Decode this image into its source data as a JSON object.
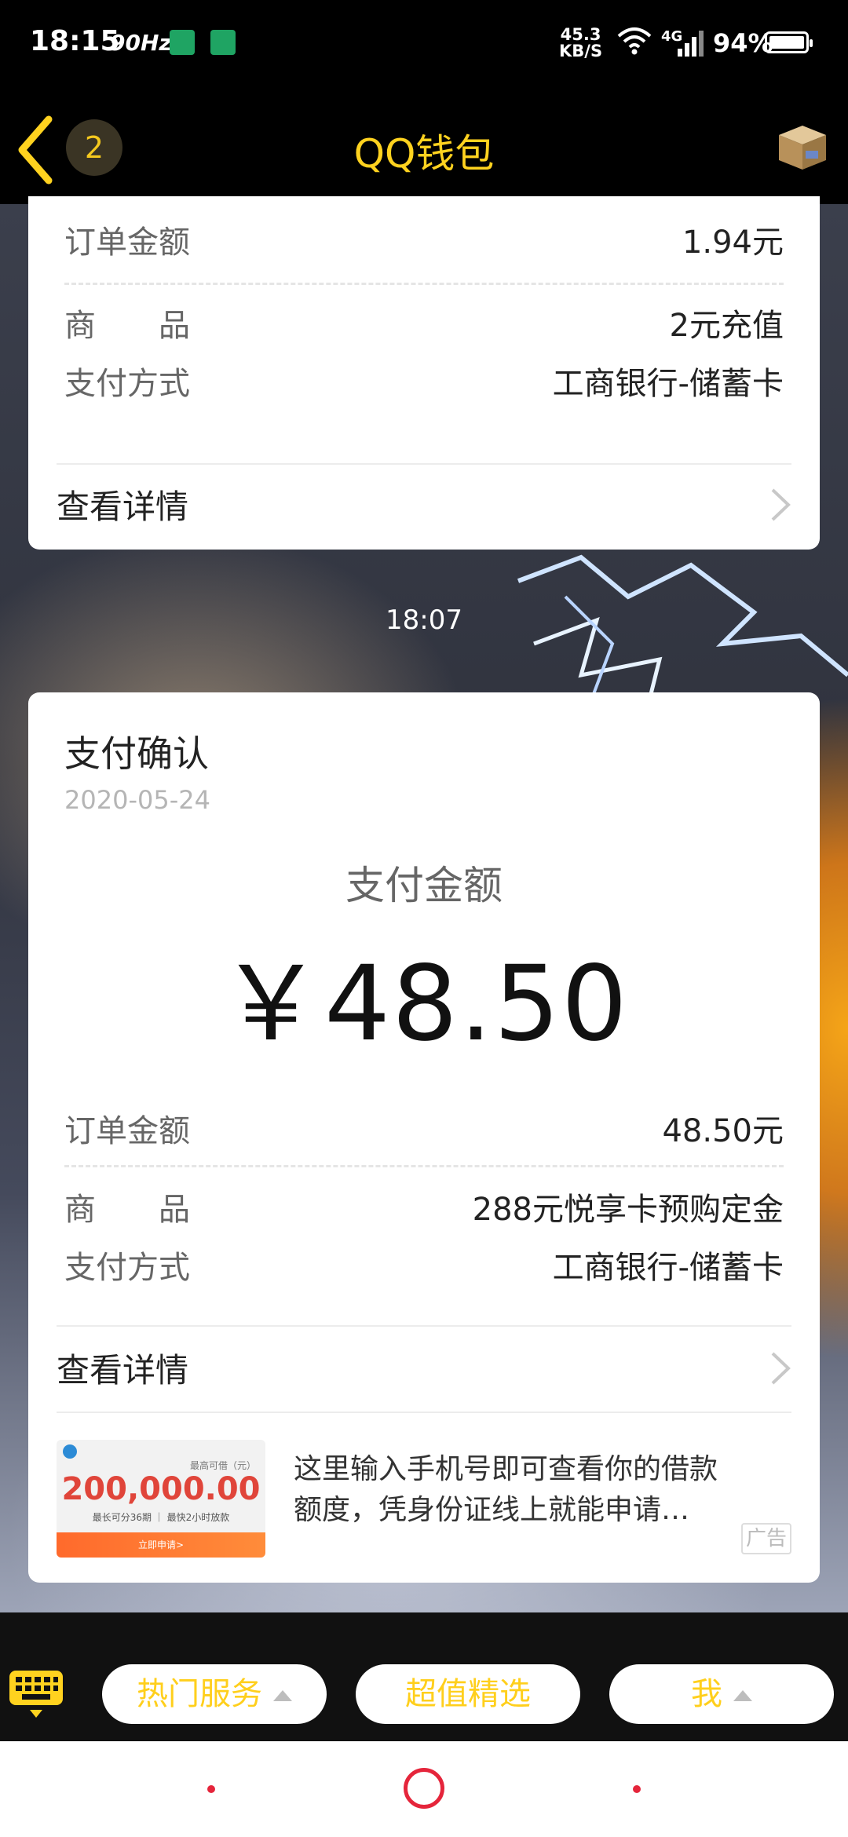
{
  "status_bar": {
    "time": "18:15",
    "refresh_rate": "90Hz",
    "net_speed_value": "45.3",
    "net_speed_unit": "KB/S",
    "network": "4G",
    "battery": "94%"
  },
  "header": {
    "title": "QQ钱包",
    "badge_count": "2"
  },
  "card1": {
    "order_amount_label": "订单金额",
    "order_amount_value": "1.94元",
    "product_label": "商　　品",
    "product_value": "2元充值",
    "payment_label": "支付方式",
    "payment_value": "工商银行-储蓄卡",
    "details_label": "查看详情"
  },
  "timestamp": "18:07",
  "card2": {
    "title": "支付确认",
    "date": "2020-05-24",
    "amount_label": "支付金额",
    "amount": "￥48.50",
    "order_amount_label": "订单金额",
    "order_amount_value": "48.50元",
    "product_label": "商　　品",
    "product_value": "288元悦享卡预购定金",
    "payment_label": "支付方式",
    "payment_value": "工商银行-储蓄卡",
    "details_label": "查看详情"
  },
  "ad": {
    "image_caption": "最高可借（元）",
    "image_amount": "200,000.00",
    "image_sub": "最长可分36期 ｜ 最快2小时放款",
    "image_button": "立即申请>",
    "text": "这里输入手机号即可查看你的借款额度，凭身份证线上就能申请…",
    "tag": "广告"
  },
  "bottom_nav": {
    "items": [
      {
        "label": "热门服务"
      },
      {
        "label": "超值精选"
      },
      {
        "label": "我"
      }
    ]
  },
  "colors": {
    "accent": "#ffd21f",
    "system_nav": "#e5253b"
  }
}
